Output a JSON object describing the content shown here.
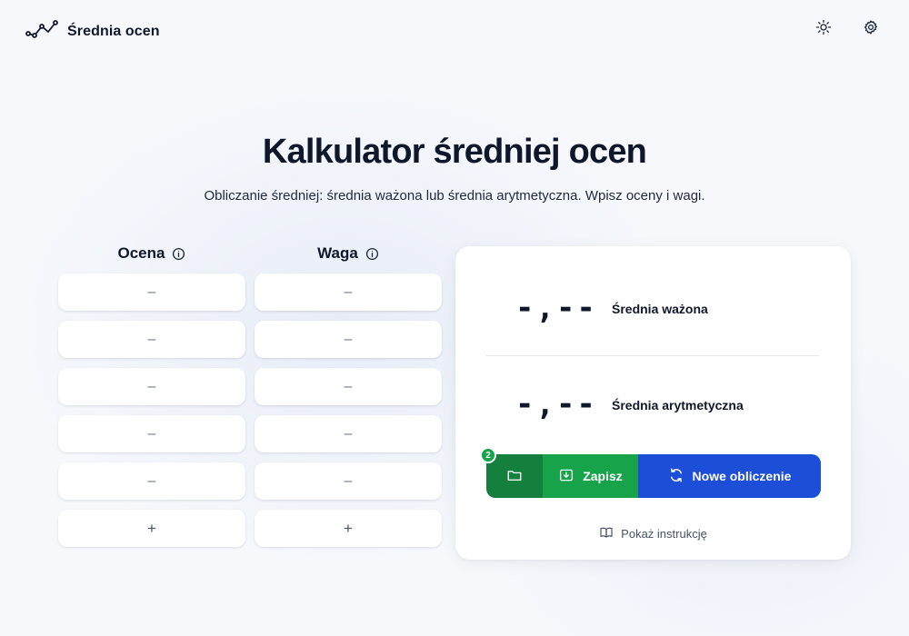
{
  "app": {
    "name": "Średnia ocen",
    "logo_icon": "trend-line-icon",
    "theme_icon": "sun-icon",
    "settings_icon": "gear-icon"
  },
  "hero": {
    "title": "Kalkulator średniej ocen",
    "subtitle": "Obliczanie średniej: średnia ważona lub średnia arytmetyczna. Wpisz oceny i wagi."
  },
  "table": {
    "grade_header": "Ocena",
    "weight_header": "Waga",
    "grades": [
      "–",
      "–",
      "–",
      "–",
      "–"
    ],
    "weights": [
      "–",
      "–",
      "–",
      "–",
      "–"
    ],
    "add_label": "+"
  },
  "results": {
    "weighted": {
      "value": "-,--",
      "label": "Średnia ważona"
    },
    "arithmetic": {
      "value": "-,--",
      "label": "Średnia arytmetyczna"
    }
  },
  "actions": {
    "saved_count": "2",
    "save_label": "Zapisz",
    "new_label": "Nowe obliczenie",
    "instructions_label": "Pokaż instrukcję"
  },
  "colors": {
    "green_dark": "#15803d",
    "green": "#16a34a",
    "blue": "#1d4ed8",
    "text": "#0f172a"
  }
}
